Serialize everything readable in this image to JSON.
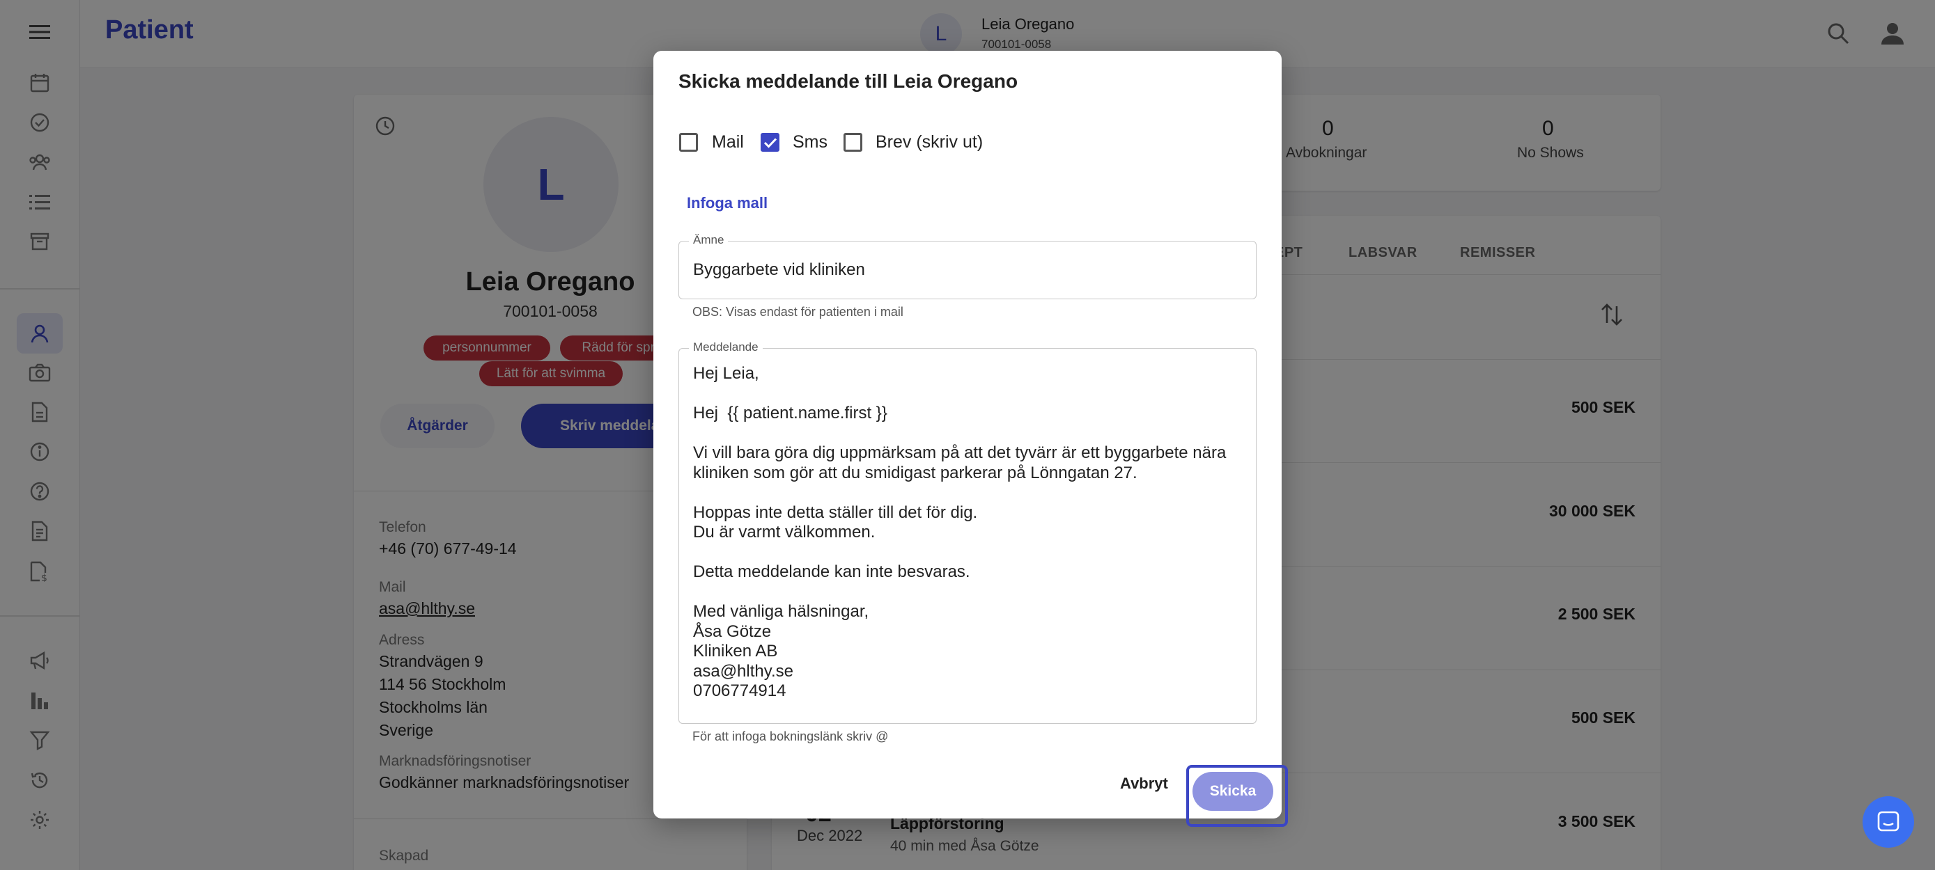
{
  "header": {
    "title": "Patient",
    "avatar_letter": "L",
    "patient_name": "Leia Oregano",
    "patient_number": "700101-0058"
  },
  "profile": {
    "avatar_letter": "L",
    "name": "Leia Oregano",
    "personal_number": "700101-0058",
    "tags": [
      "personnummer",
      "Rädd för sprutor",
      "Lätt för att svimma"
    ],
    "actions_label": "Åtgärder",
    "write_label": "Skriv meddelande",
    "fields": [
      {
        "label": "Telefon",
        "value": "+46 (70) 677-49-14"
      },
      {
        "label": "Mail",
        "value": "asa@hlthy.se"
      },
      {
        "label": "Adress",
        "value": "Strandvägen 9\n114 56 Stockholm\nStockholms län\nSverige"
      },
      {
        "label": "Marknadsföringsnotiser",
        "value": "Godkänner marknadsföringsnotiser"
      },
      {
        "label": "Skapad",
        "value": ""
      }
    ]
  },
  "stats": [
    {
      "value": "0",
      "label": "Avbokningar"
    },
    {
      "value": "0",
      "label": "No Shows"
    }
  ],
  "list": {
    "tabs": [
      "EPT",
      "LABSVAR",
      "REMISSER"
    ],
    "prices": [
      "500 SEK",
      "30 000 SEK",
      "2 500 SEK",
      "500 SEK",
      "3 500 SEK"
    ],
    "last_row": {
      "day": "02",
      "month": "Dec 2022",
      "title": "Läppförstoring",
      "subtitle": "40 min med Åsa Götze"
    }
  },
  "dialog": {
    "title": "Skicka meddelande till Leia Oregano",
    "channels": [
      {
        "label": "Mail",
        "checked": false
      },
      {
        "label": "Sms",
        "checked": true
      },
      {
        "label": "Brev (skriv ut)",
        "checked": false
      }
    ],
    "insert_template": "Infoga mall",
    "subject": {
      "label": "Ämne",
      "value": "Byggarbete vid kliniken",
      "helper": "OBS: Visas endast för patienten i mail"
    },
    "message": {
      "label": "Meddelande",
      "value": "Hej Leia,\n\nHej  {{ patient.name.first }}\n\nVi vill bara göra dig uppmärksam på att det tyvärr är ett byggarbete nära kliniken som gör att du smidigast parkerar på Lönngatan 27.\n\nHoppas inte detta ställer till det för dig.\nDu är varmt välkommen.\n\nDetta meddelande kan inte besvaras.\n\nMed vänliga hälsningar,\nÅsa Götze\nKliniken AB\nasa@hlthy.se\n0706774914",
      "helper": "För att infoga bokningslänk skriv @"
    },
    "cancel_label": "Avbryt",
    "send_label": "Skicka"
  },
  "colors": {
    "brand": "#3b46c4",
    "tag": "#c4323e",
    "send_disabled": "#8e93e0",
    "chat": "#3b6ff0"
  }
}
